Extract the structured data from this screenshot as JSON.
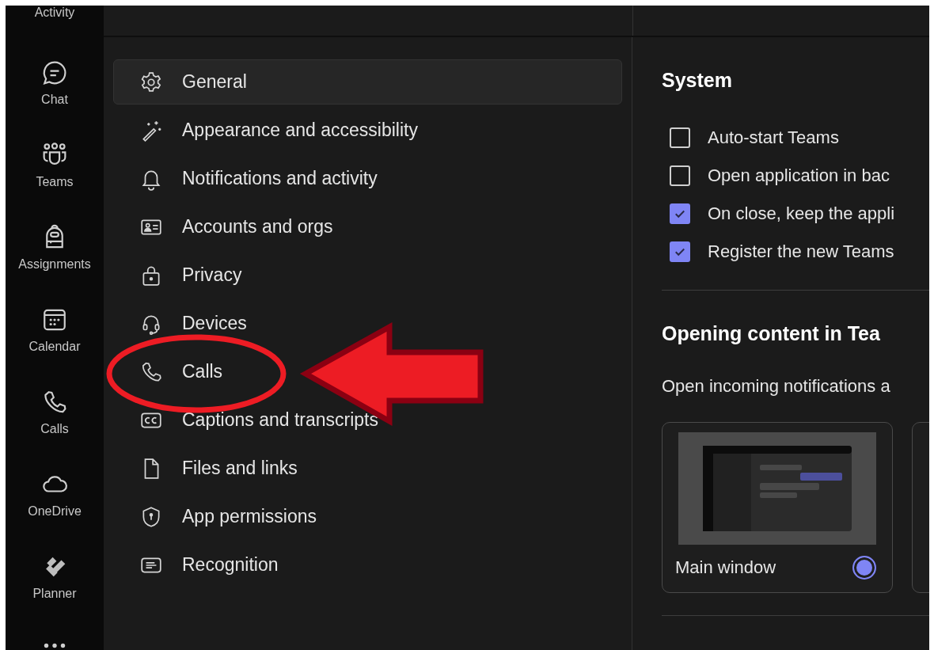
{
  "rail": [
    {
      "label": "Activity"
    },
    {
      "label": "Chat"
    },
    {
      "label": "Teams"
    },
    {
      "label": "Assignments"
    },
    {
      "label": "Calendar"
    },
    {
      "label": "Calls"
    },
    {
      "label": "OneDrive"
    },
    {
      "label": "Planner"
    }
  ],
  "settings_menu": [
    {
      "label": "General",
      "selected": true
    },
    {
      "label": "Appearance and accessibility",
      "selected": false
    },
    {
      "label": "Notifications and activity",
      "selected": false
    },
    {
      "label": "Accounts and orgs",
      "selected": false
    },
    {
      "label": "Privacy",
      "selected": false
    },
    {
      "label": "Devices",
      "selected": false
    },
    {
      "label": "Calls",
      "selected": false
    },
    {
      "label": "Captions and transcripts",
      "selected": false
    },
    {
      "label": "Files and links",
      "selected": false
    },
    {
      "label": "App permissions",
      "selected": false
    },
    {
      "label": "Recognition",
      "selected": false
    }
  ],
  "system": {
    "heading": "System",
    "options": [
      {
        "label": "Auto-start Teams",
        "checked": false
      },
      {
        "label": "Open application in bac",
        "checked": false
      },
      {
        "label": "On close, keep the appli",
        "checked": true
      },
      {
        "label": "Register the new Teams",
        "checked": true
      }
    ]
  },
  "opening_content": {
    "heading": "Opening content in Tea",
    "description": "Open incoming notifications a",
    "choices": [
      {
        "label": "Main window",
        "selected": true
      }
    ]
  }
}
